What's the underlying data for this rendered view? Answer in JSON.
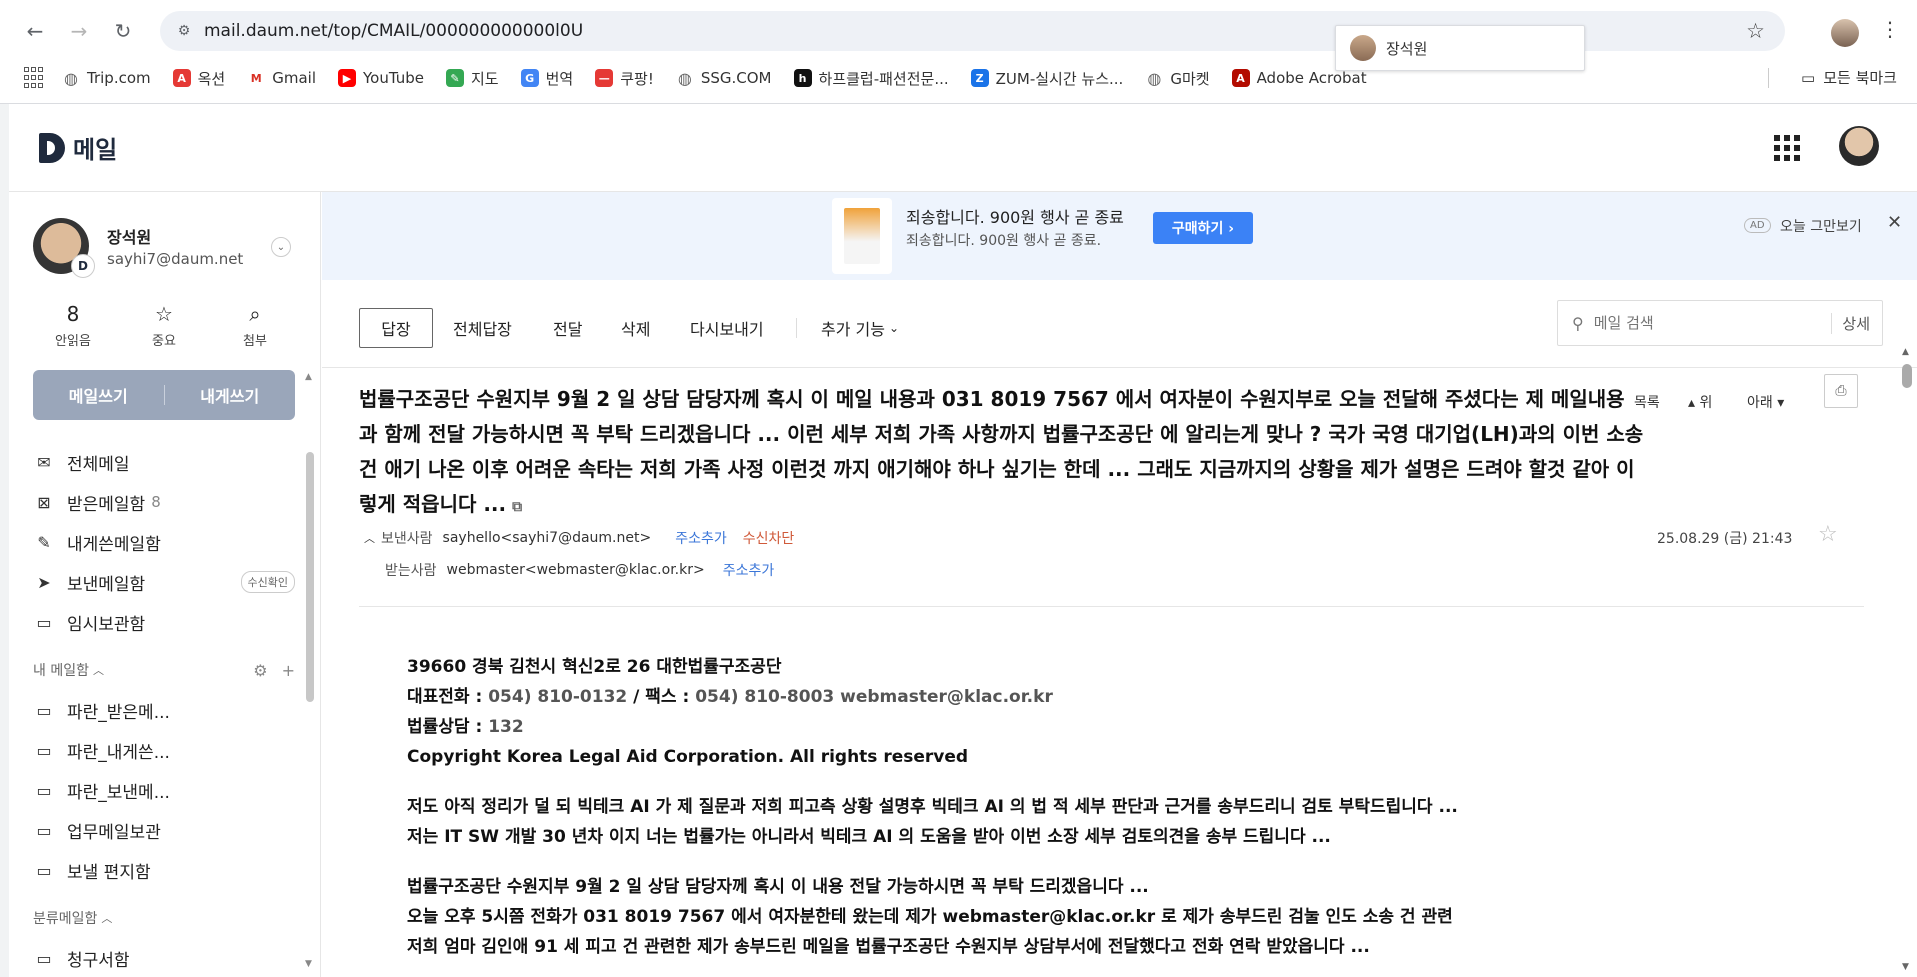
{
  "browser": {
    "url": "mail.daum.net/top/CMAIL/000000000000l0U",
    "profile_popup_name": "장석원",
    "bookmarks": [
      {
        "label": "Trip.com",
        "color": "#666",
        "glyph": "◍"
      },
      {
        "label": "옥션",
        "color": "#e53935",
        "glyph": "A"
      },
      {
        "label": "Gmail",
        "color": "#ffffff",
        "glyph": "M"
      },
      {
        "label": "YouTube",
        "color": "#ff0000",
        "glyph": "▶"
      },
      {
        "label": "지도",
        "color": "#34a853",
        "glyph": "✎"
      },
      {
        "label": "번역",
        "color": "#4285f4",
        "glyph": "G"
      },
      {
        "label": "쿠팡!",
        "color": "#e53935",
        "glyph": "—"
      },
      {
        "label": "SSG.COM",
        "color": "#666",
        "glyph": "◍"
      },
      {
        "label": "하프클럽-패션전문...",
        "color": "#111",
        "glyph": "h"
      },
      {
        "label": "ZUM-실시간 뉴스...",
        "color": "#1a73e8",
        "glyph": "Z"
      },
      {
        "label": "G마켓",
        "color": "#666",
        "glyph": "◍"
      },
      {
        "label": "Adobe Acrobat",
        "color": "#b30b00",
        "glyph": "A"
      }
    ],
    "all_bookmarks": "모든 북마크"
  },
  "header": {
    "logo_text": "메일"
  },
  "user": {
    "name": "장석원",
    "email": "sayhi7@daum.net",
    "badge": "D"
  },
  "stats": [
    {
      "value": "8",
      "label": "안읽음"
    },
    {
      "icon": "star-icon",
      "label": "중요"
    },
    {
      "icon": "paperclip-icon",
      "label": "첨부"
    }
  ],
  "compose": {
    "write": "메일쓰기",
    "self": "내게쓰기"
  },
  "folders": [
    {
      "label": "전체메일",
      "icon": "mail-icon",
      "glyph": "✉"
    },
    {
      "label": "받은메일함",
      "icon": "inbox-icon",
      "glyph": "⊠",
      "count": "8"
    },
    {
      "label": "내게쓴메일함",
      "icon": "note-icon",
      "glyph": "✎"
    },
    {
      "label": "보낸메일함",
      "icon": "send-icon",
      "glyph": "➤",
      "pill": "수신확인"
    },
    {
      "label": "임시보관함",
      "icon": "folder-icon",
      "glyph": "▭"
    }
  ],
  "my_folders_title": "내 메일함",
  "my_folders": [
    {
      "label": "파란_받은메..."
    },
    {
      "label": "파란_내게쓴..."
    },
    {
      "label": "파란_보낸메..."
    },
    {
      "label": "업무메일보관"
    },
    {
      "label": "보낼 편지함"
    }
  ],
  "category_title": "분류메일함",
  "category_partial": "청구서함",
  "ad": {
    "title": "죄송합니다. 900원 행사 곧 종료",
    "subtitle": "죄송합니다. 900원 행사 곧 종료.",
    "buy": "구매하기 ›",
    "tag": "AD",
    "skip": "오늘 그만보기"
  },
  "toolbar": {
    "reply": "답장",
    "reply_all": "전체답장",
    "forward": "전달",
    "delete": "삭제",
    "resend": "다시보내기",
    "more": "추가 기능",
    "search_placeholder": "메일 검색",
    "search_detail": "상세"
  },
  "message": {
    "subject": "법률구조공단 수원지부 9월 2 일 상담 담당자께 혹시 이 메일 내용과 031 8019 7567 에서 여자분이 수원지부로 오늘 전달해 주셨다는 제 메일내용 과 함께 전달 가능하시면 꼭 부탁 드리겠읍니다 ... 이런 세부 저희 가족 사항까지 법률구조공단 에 알리는게 맞나 ? 국가 국영 대기업(LH)과의 이번 소송 건 애기 나온 이후 어려운 속타는 저희 가족 사정 이런것 까지 애기해야 하나 싶기는 한데 ... 그래도 지금까지의 상황을 제가 설명은 드려야 할것 같아 이렇게 적읍니다 ...",
    "nav_list": "목록",
    "nav_up": "▴ 위",
    "nav_down": "아래 ▾",
    "sender_label": "보낸사람",
    "sender": "sayhello<sayhi7@daum.net>",
    "add_contact": "주소추가",
    "block": "수신차단",
    "recipient_label": "받는사람",
    "recipient": "webmaster<webmaster@klac.or.kr>",
    "date": "25.08.29 (금) 21:43"
  },
  "body": {
    "l1": "39660 경북 김천시 혁신2로 26 대한법률구조공단",
    "l2a": "대표전화 : ",
    "l2b": "054) 810-0132",
    "l2c": " / 팩스 : ",
    "l2d": "054) 810-8003",
    "l2e": " webmaster@klac.or.kr",
    "l3a": "법률상담 : ",
    "l3b": "132",
    "l4": "Copyright Korea Legal Aid Corporation. All rights reserved",
    "l5": "저도 아직 정리가 덜 되 빅테크 AI 가 제 질문과 저희 피고측 상황 설명후 빅테크 AI 의 법 적 세부 판단과 근거를 송부드리니 검토 부탁드립니다 ...",
    "l6": "저는 IT SW 개발 30 년차 이지 너는 법률가는 아니라서 빅테크 AI 의 도움을 받아 이번 소장 세부 검토의견을 송부 드립니다 ...",
    "l7": "법률구조공단 수원지부 9월 2 일 상담 담당자께 혹시 이 내용 전달 가능하시면 꼭 부탁 드리겠읍니다 ...",
    "l8": "오늘 오후 5시쯤 전화가 031 8019 7567 에서 여자분한테 왔는데 제가 webmaster@klac.or.kr 로 제가 송부드린 검눌 인도 소송 건 관련",
    "l9": "저희 엄마 김인애 91 세 피고 건 관련한 제가 송부드린 메일을  법률구조공단 수원지부 상담부서에 전달했다고 전화 연락 받았읍니다  ..."
  }
}
